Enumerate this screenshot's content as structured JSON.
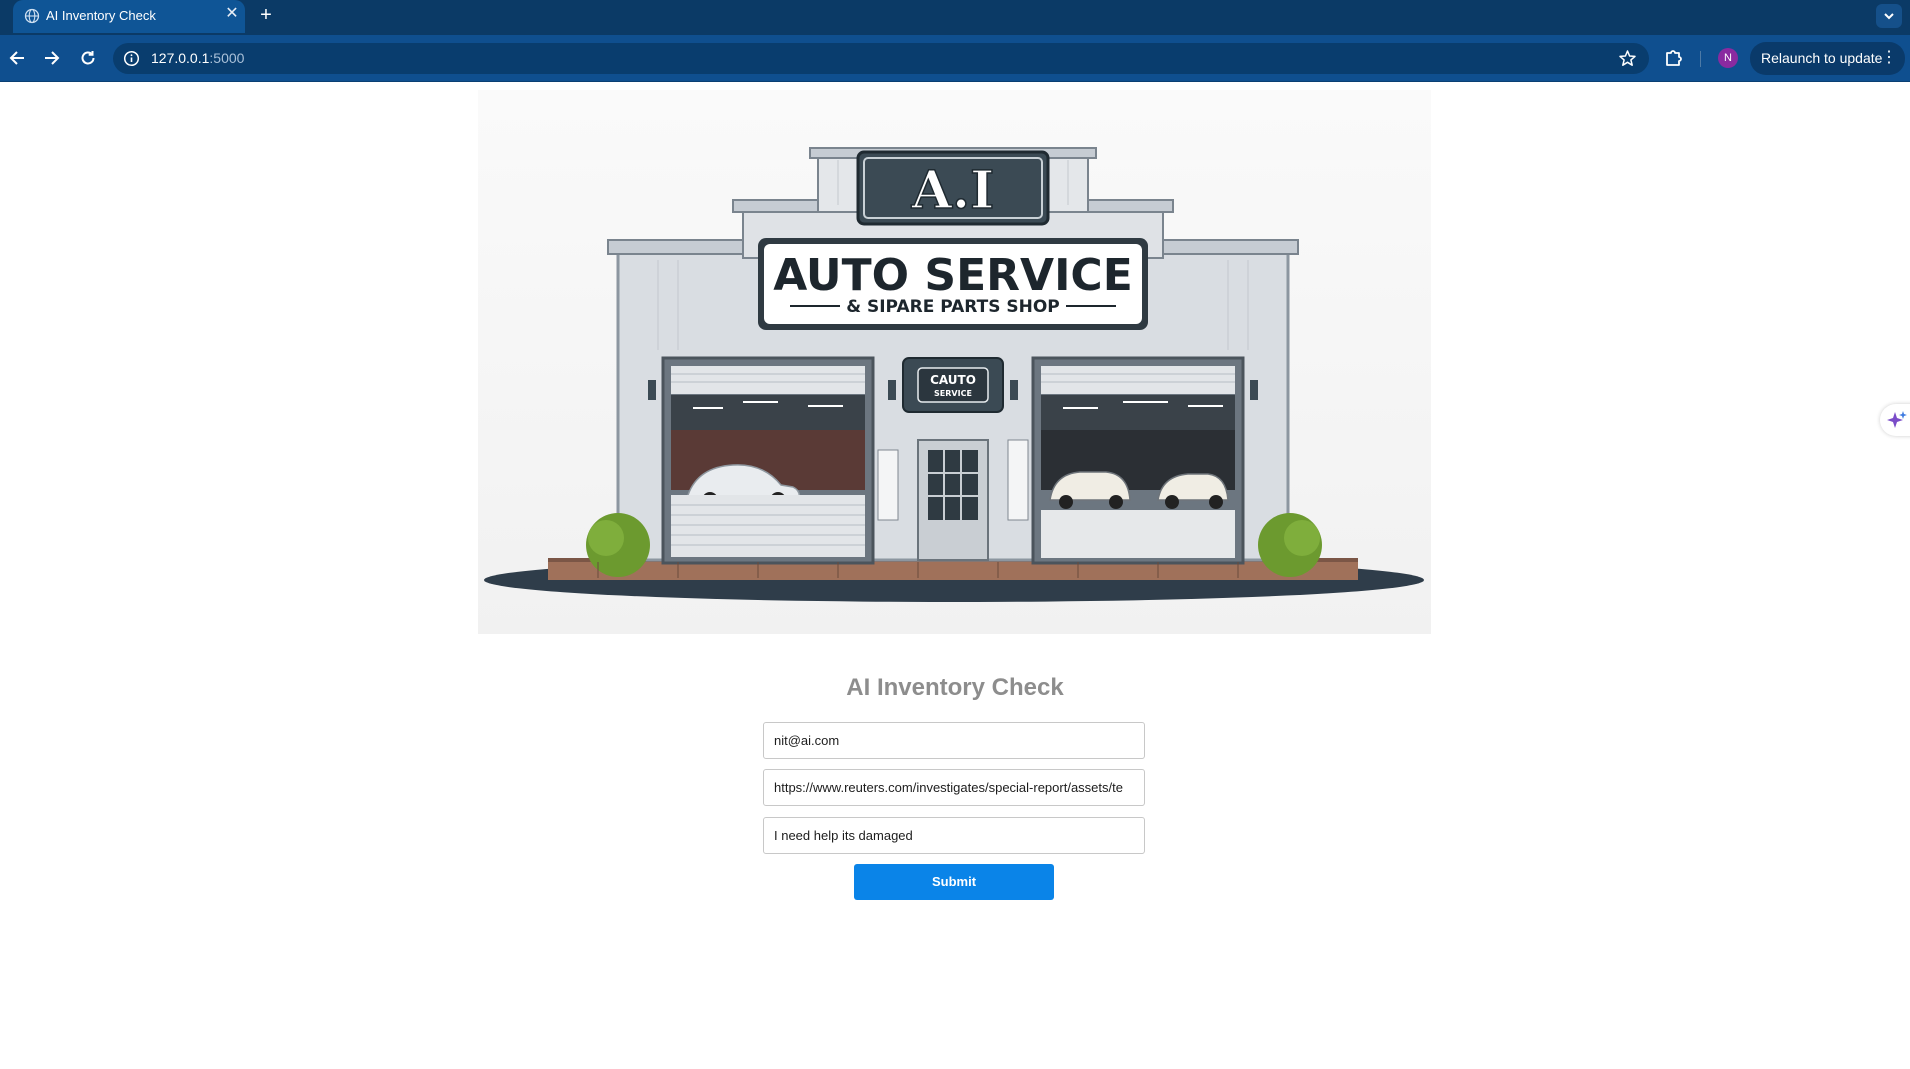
{
  "browser": {
    "tab_title": "AI Inventory Check",
    "tab_close": "✕",
    "new_tab": "+",
    "url_host": "127.0.0.1",
    "url_port": ":5000",
    "profile_initial": "N",
    "relaunch_label": "Relaunch to update",
    "menu_dots": "⋮"
  },
  "hero": {
    "sign_top": "A.I",
    "sign_main": "AUTO SERVICE",
    "sign_sub": "& SIPARE PARTS SHOP",
    "small_sign_line1": "CAUTO",
    "small_sign_line2": "SERVICE"
  },
  "form": {
    "title": "AI Inventory Check",
    "email_value": "nit@ai.com",
    "url_value": "https://www.reuters.com/investigates/special-report/assets/te",
    "message_value": "I need help its damaged",
    "submit_label": "Submit"
  },
  "colors": {
    "tabbar": "#0b3a66",
    "toolbar": "#0f4f8f",
    "submit": "#0a84e8",
    "title_gray": "#8d8d8d"
  }
}
